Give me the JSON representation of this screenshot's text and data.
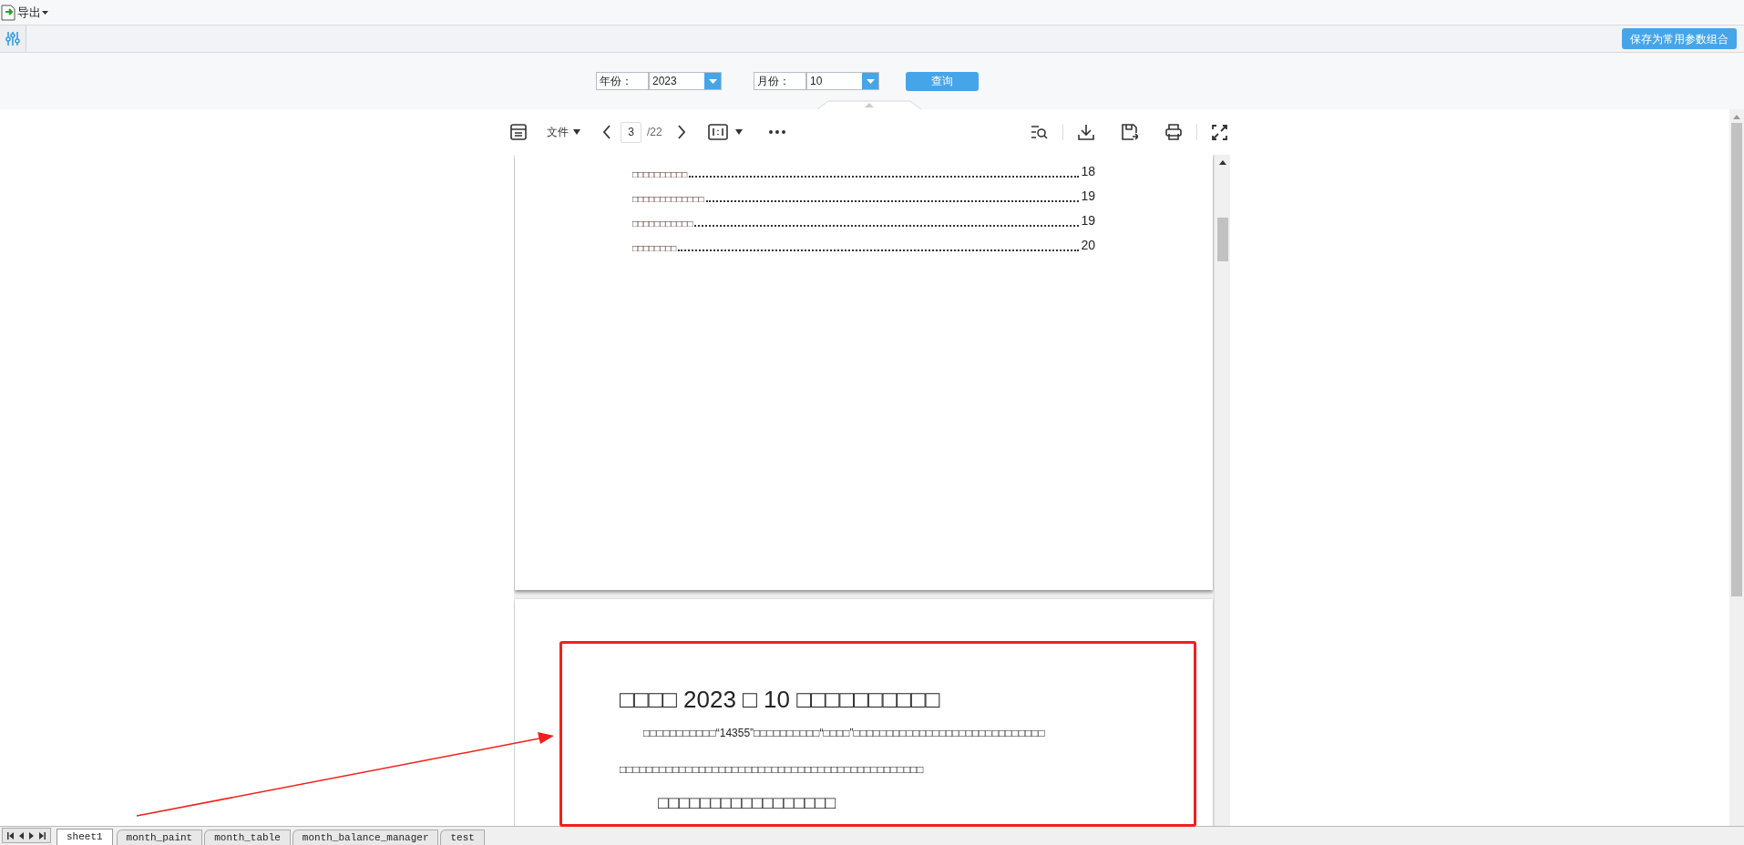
{
  "toolbar": {
    "export_label": "导出"
  },
  "save_button": "保存为常用参数组合",
  "params": [
    {
      "label": "年份：",
      "value": "2023"
    },
    {
      "label": "月份：",
      "value": "10"
    }
  ],
  "query_button": "查询",
  "viewer_toolbar": {
    "file_menu": "文件",
    "page": "3",
    "page_total": "/22"
  },
  "toc": [
    {
      "title": "□□□□□□□□□□",
      "page": "18"
    },
    {
      "title": "□□□□□□□□□□□□□",
      "page": "19"
    },
    {
      "title": "□□□□□□□□□□□",
      "page": "19"
    },
    {
      "title": "□□□□□□□□",
      "page": "20"
    }
  ],
  "page2": {
    "title": "□□□□ 2023 □ 10 □□□□□□□□□□",
    "paragraphs": [
      "□□□□□□□□□□□“14355”□□□□□□□□□□“□□□□”□□□□□□□□□□□□□□□□□□□□□□□□□□□□□",
      "□□□□□□□□□□□□□□□□□□□□□□□□□□□□□□□□□□□□□□□□□□□□□□"
    ],
    "heading": "□□□□□□□□□□□□□□□□□"
  },
  "sheet_tabs": [
    {
      "label": "sheet1",
      "selected": true
    },
    {
      "label": "month_paint",
      "selected": false
    },
    {
      "label": "month_table",
      "selected": false
    },
    {
      "label": "month_balance_manager",
      "selected": false
    },
    {
      "label": "test",
      "selected": false
    }
  ]
}
